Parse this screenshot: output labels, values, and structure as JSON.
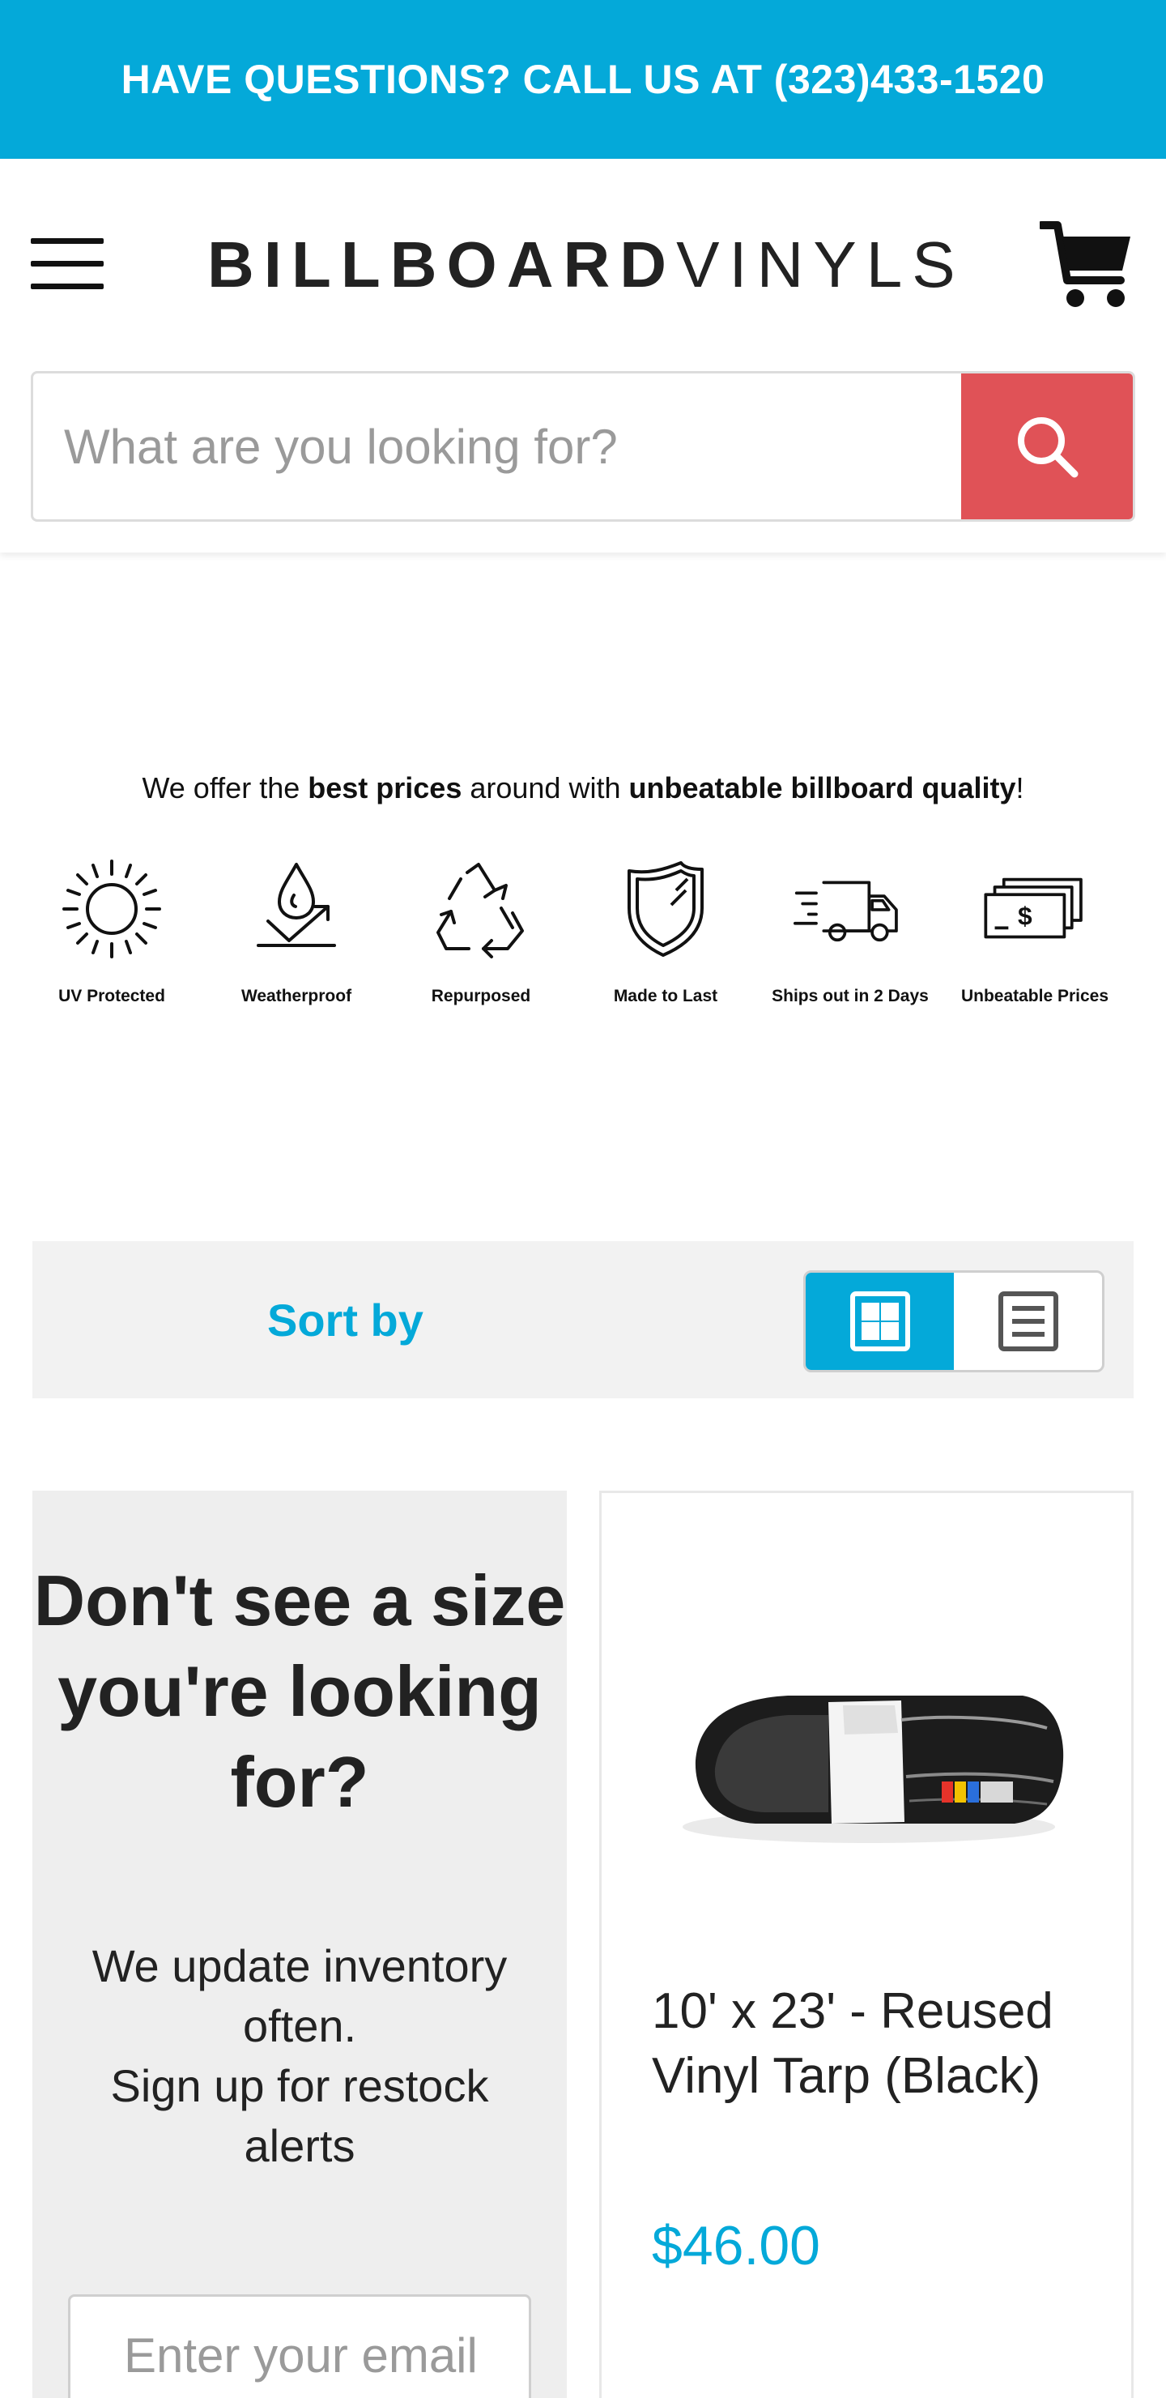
{
  "announcement": {
    "text": "HAVE QUESTIONS? CALL US AT (323)433-1520"
  },
  "header": {
    "logo_bold": "BILLBOARD",
    "logo_light": "VINYLS",
    "search_placeholder": "What are you looking for?"
  },
  "promo": {
    "part1": "We offer the ",
    "bold1": "best prices",
    "part2": " around with ",
    "bold2": "unbeatable billboard quality",
    "part3": "!"
  },
  "features": [
    {
      "label": "UV Protected",
      "icon": "sun-icon"
    },
    {
      "label": "Weatherproof",
      "icon": "water-drop-icon"
    },
    {
      "label": "Repurposed",
      "icon": "recycle-icon"
    },
    {
      "label": "Made to Last",
      "icon": "shield-icon"
    },
    {
      "label": "Ships out in 2 Days",
      "icon": "truck-icon"
    },
    {
      "label": "Unbeatable Prices",
      "icon": "cash-icon"
    }
  ],
  "toolbar": {
    "sort_label": "Sort by",
    "active_view": "grid"
  },
  "restock": {
    "heading": "Don't see a size you're looking for?",
    "sub1": "We update inventory often.",
    "sub2": "Sign up for restock alerts",
    "email_placeholder": "Enter your email"
  },
  "product": {
    "title": "10' x 23' - Reused Vinyl Tarp (Black)",
    "price": "$46.00"
  },
  "colors": {
    "accent": "#04a9d9",
    "search_button": "#e05257",
    "panel": "#f2f2f2"
  }
}
